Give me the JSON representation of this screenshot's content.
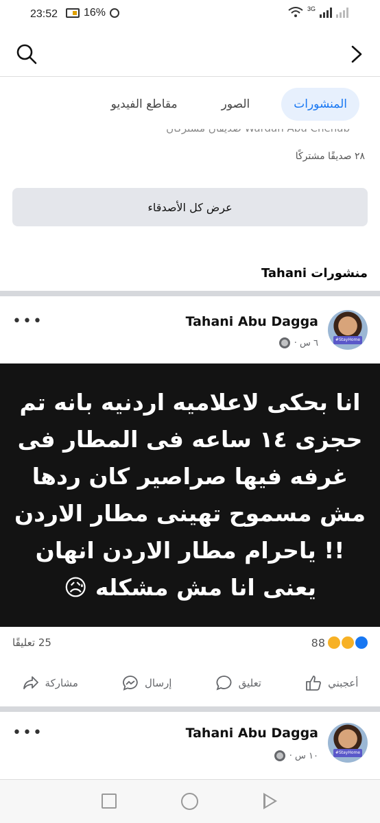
{
  "status_bar": {
    "time": "23:52",
    "battery": "16%",
    "network": "3G"
  },
  "tabs": [
    {
      "label": "المنشورات",
      "active": true
    },
    {
      "label": "الصور",
      "active": false
    },
    {
      "label": "مقاطع الفيديو",
      "active": false
    }
  ],
  "friends": {
    "cut_names": "Wardah   Abu Chenab   صديقان مشتركان",
    "mutual": "٢٨ صديقًا مشتركًا",
    "show_all": "عرض كل الأصدقاء"
  },
  "posts_title": "منشورات Tahani",
  "posts": [
    {
      "author": "Tahani Abu Dagga",
      "time": "٦ س ·",
      "text": "انا بحكى لاعلاميه اردنيه بانه تم حجزى ١٤ ساعه فى المطار فى غرفه فيها صراصير كان ردها مش مسموح تهينى مطار الاردن !! ياحرام مطار الاردن انهان يعنى انا مش مشكله 😥",
      "reactions": "88",
      "comments": "25 تعليقًا"
    },
    {
      "author": "Tahani Abu Dagga",
      "time": "١٠ س ·"
    }
  ],
  "actions": {
    "like": "أعجبني",
    "comment": "تعليق",
    "send": "إرسال",
    "share": "مشاركة"
  },
  "avatar_badge": "#StayHome",
  "colors": {
    "accent": "#1877f2",
    "tab_active_bg": "#e7f0fd",
    "post_bg": "#131313"
  }
}
